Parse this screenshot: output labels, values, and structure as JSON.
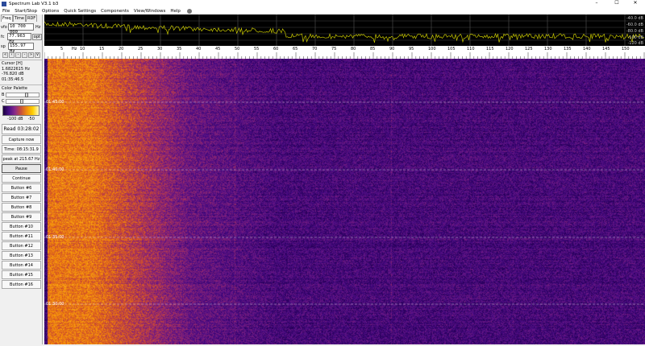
{
  "window": {
    "title": "Spectrum Lab V3.1 b3",
    "controls": [
      "–",
      "☐",
      "✕"
    ]
  },
  "menu": [
    "File",
    "Start/Stop",
    "Options",
    "Quick Settings",
    "Components",
    "View/Windows",
    "Help"
  ],
  "left": {
    "tabs": [
      "Freq",
      "Time",
      "RDF"
    ],
    "fields": [
      {
        "label": "vfo",
        "value": "10 700 000",
        "unit": "Hz"
      },
      {
        "label": "fc",
        "value": "77.963 Hz",
        "unit": "opt"
      },
      {
        "label": "sp",
        "value": "155.97 Hz",
        "unit": ""
      }
    ],
    "arrows": [
      "«",
      "‹",
      "-",
      "-",
      "»",
      "v"
    ],
    "cursor": {
      "title": "Cursor [H]",
      "freq": "1.6822615 Hz",
      "level": "-76.820 dB",
      "time": "01:35:46.5"
    },
    "palette": {
      "title": "Color Palette",
      "b_label": "B",
      "c_label": "C",
      "b_level": 0.6,
      "c_level": 0.45,
      "min": "-100 dB",
      "max": "-50"
    },
    "buttons": [
      "Read 03:28:02",
      "Capture now",
      "Time: 08:15:31.9",
      "peak at 215.67 Hz",
      "Pause",
      "Continue",
      "Button #6",
      "Button #7",
      "Button #8",
      "Button #9",
      "Button #10",
      "Button #11",
      "Button #12",
      "Button #13",
      "Button #14",
      "Button #15",
      "Button #16"
    ]
  },
  "spectrum": {
    "db_labels": [
      "-40.0 dB",
      "-60.0 dB",
      "-80.0 dB",
      "-100 dB",
      "-120 dB"
    ],
    "trace_color": "#c8c800"
  },
  "scale": {
    "unit": "Hz",
    "labels": [
      "5",
      "10",
      "15",
      "20",
      "25",
      "30",
      "35",
      "40",
      "45",
      "50",
      "55",
      "60",
      "65",
      "70",
      "75",
      "80",
      "85",
      "90",
      "95",
      "100",
      "105",
      "110",
      "115",
      "120",
      "125",
      "130",
      "135",
      "140",
      "145",
      "150"
    ]
  },
  "waterfall": {
    "times": [
      "01:45:00",
      "01:40:00",
      "01:35:00",
      "01:30:00"
    ]
  }
}
